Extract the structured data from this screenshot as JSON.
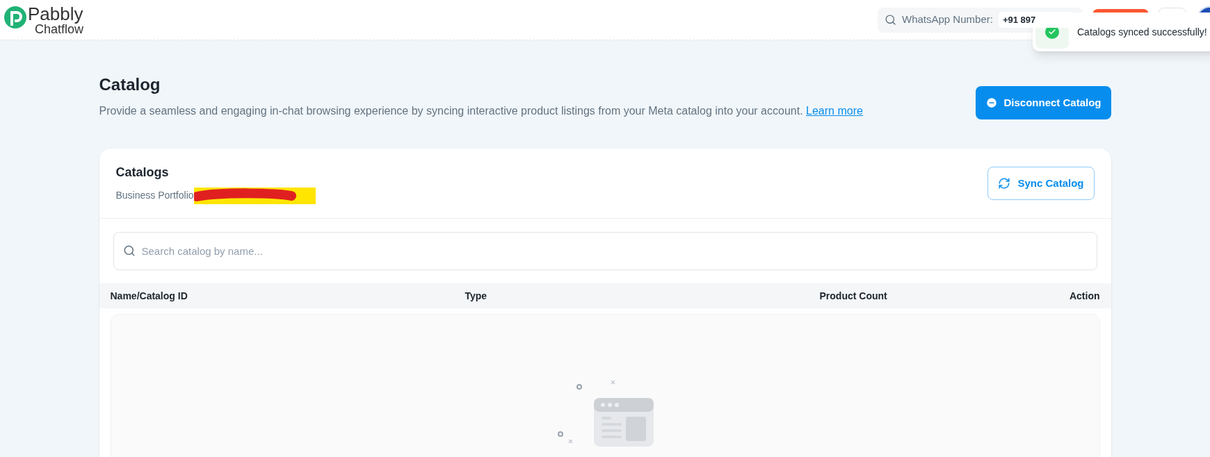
{
  "logo": {
    "name": "Pabbly",
    "product": "Chatflow"
  },
  "header": {
    "whatsapp_label": "WhatsApp Number:",
    "whatsapp_value": "+91 897"
  },
  "toast": {
    "message": "Catalogs synced successfully!"
  },
  "page": {
    "title": "Catalog",
    "description": "Provide a seamless and engaging in-chat browsing experience by syncing interactive product listings from your Meta catalog into your account.",
    "link": "Learn more",
    "disconnect_button": "Disconnect Catalog"
  },
  "card": {
    "title": "Catalogs",
    "subtitle": "Business Portfolio",
    "sync_button": "Sync Catalog",
    "search": {
      "placeholder": "Search catalog by name..."
    },
    "columns": [
      "Name/Catalog ID",
      "Type",
      "Product Count",
      "Action"
    ]
  }
}
